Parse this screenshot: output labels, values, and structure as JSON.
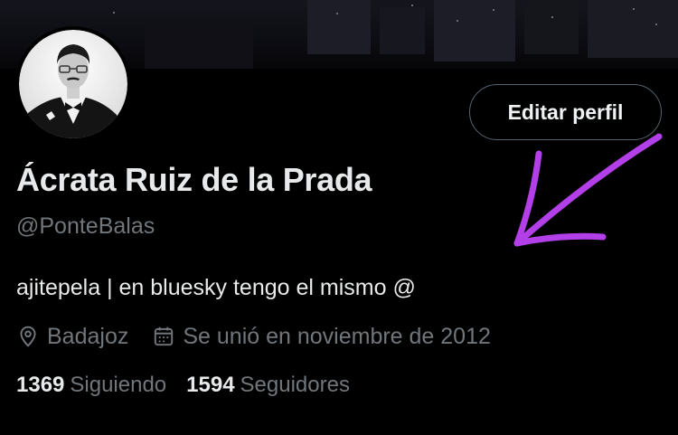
{
  "profile": {
    "display_name": "Ácrata Ruiz de la Prada",
    "handle": "@PonteBalas",
    "bio": "ajitepela | en bluesky tengo el mismo @",
    "location": "Badajoz",
    "joined": "Se unió en noviembre de 2012",
    "following_count": "1369",
    "following_label": "Siguiendo",
    "followers_count": "1594",
    "followers_label": "Seguidores"
  },
  "actions": {
    "edit_profile_label": "Editar perfil"
  },
  "icons": {
    "location": "location-pin-icon",
    "joined": "calendar-icon"
  },
  "colors": {
    "background": "#000000",
    "primary_text": "#e7e9ea",
    "secondary_text": "#71767b",
    "button_border": "#536471",
    "annotation_arrow": "#b23fe8"
  }
}
